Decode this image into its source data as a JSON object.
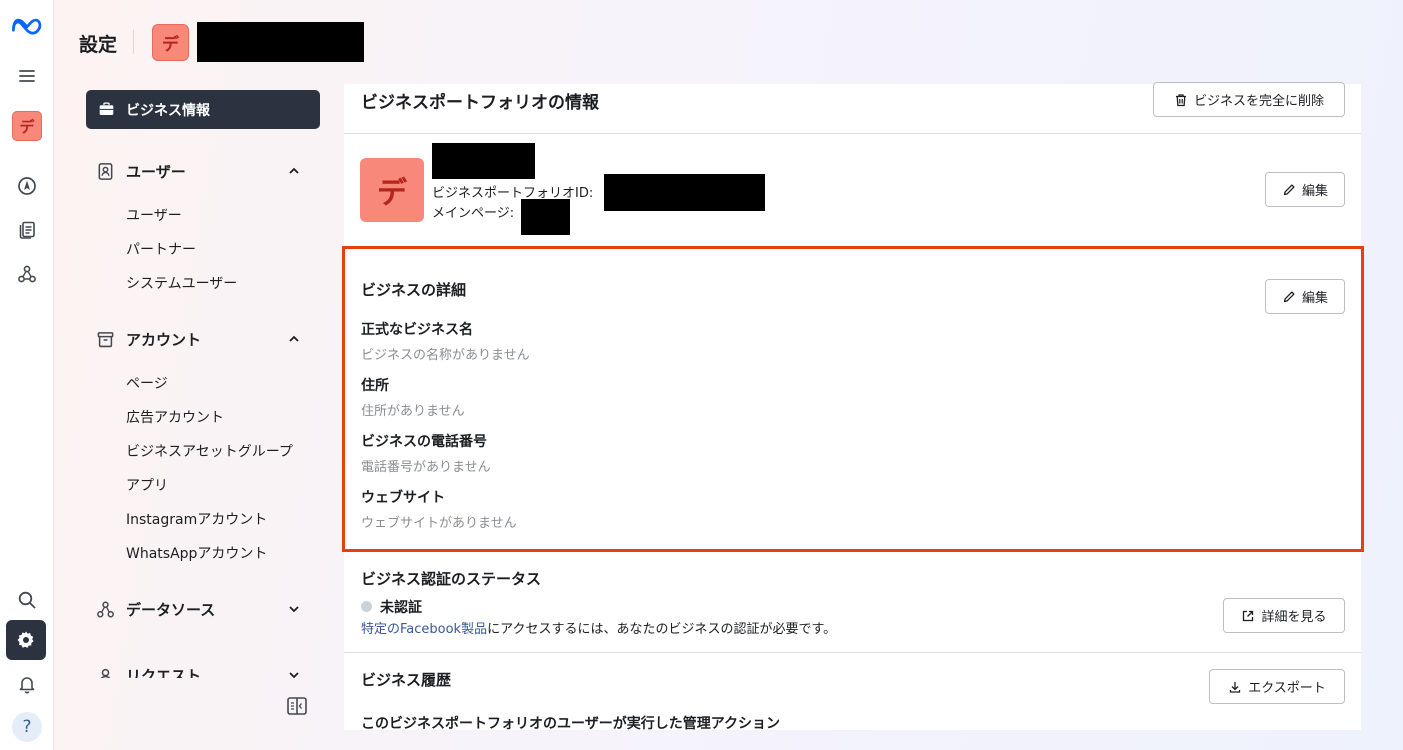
{
  "rail": {
    "avatar_letter": "デ",
    "help_label": "?"
  },
  "header": {
    "title": "設定",
    "avatar_letter": "デ"
  },
  "sidenav": {
    "active_item": "ビジネス情報",
    "sections": [
      {
        "label": "ユーザー",
        "expanded": true,
        "items": [
          "ユーザー",
          "パートナー",
          "システムユーザー"
        ]
      },
      {
        "label": "アカウント",
        "expanded": true,
        "items": [
          "ページ",
          "広告アカウント",
          "ビジネスアセットグループ",
          "アプリ",
          "Instagramアカウント",
          "WhatsAppアカウント"
        ]
      },
      {
        "label": "データソース",
        "expanded": false,
        "items": []
      },
      {
        "label": "リクエスト",
        "expanded": false,
        "items": []
      }
    ]
  },
  "main": {
    "info_title": "ビジネスポートフォリオの情報",
    "delete_button": "ビジネスを完全に削除",
    "portfolio": {
      "avatar_letter": "デ",
      "id_label": "ビジネスポートフォリオID:",
      "main_page_label": "メインページ:",
      "edit_button": "編集"
    },
    "details": {
      "title": "ビジネスの詳細",
      "edit_button": "編集",
      "fields": [
        {
          "label": "正式なビジネス名",
          "value": "ビジネスの名称がありません"
        },
        {
          "label": "住所",
          "value": "住所がありません"
        },
        {
          "label": "ビジネスの電話番号",
          "value": "電話番号がありません"
        },
        {
          "label": "ウェブサイト",
          "value": "ウェブサイトがありません"
        }
      ]
    },
    "verification": {
      "title": "ビジネス認証のステータス",
      "status": "未認証",
      "note_link": "特定のFacebook製品",
      "note_rest": "にアクセスするには、あなたのビジネスの認証が必要です。",
      "details_button": "詳細を見る"
    },
    "history": {
      "title": "ビジネス履歴",
      "export_button": "エクスポート",
      "subtitle": "このビジネスポートフォリオのユーザーが実行した管理アクション"
    }
  },
  "colors": {
    "accent_dark": "#2b3340",
    "avatar_bg": "#f7887a",
    "highlight": "#e8400c",
    "link": "#385898"
  }
}
